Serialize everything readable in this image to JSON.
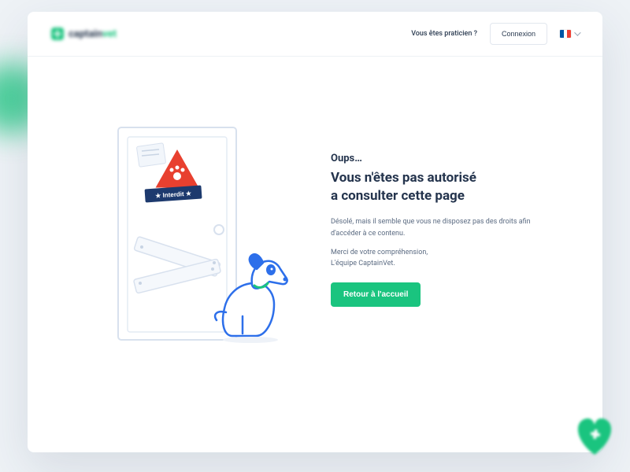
{
  "logo": {
    "text_a": "captain",
    "text_b": "vet"
  },
  "nav": {
    "practitioner": "Vous êtes praticien ?",
    "login": "Connexion",
    "language": "fr"
  },
  "page": {
    "eyebrow": "Oups…",
    "title_line1": "Vous n'êtes pas autorisé",
    "title_line2": "a consulter cette page",
    "desc": "Désolé, mais il semble que vous ne disposez pas des droits afin d'accéder à ce contenu.",
    "thanks_line1": "Merci de votre compréhension,",
    "thanks_line2": "L'équipe CaptainVet.",
    "cta": "Retour à l'accueil",
    "sign_label": "Interdit"
  },
  "colors": {
    "accent": "#1ac47f",
    "danger": "#e8402f",
    "navy": "#1d3a6e"
  }
}
